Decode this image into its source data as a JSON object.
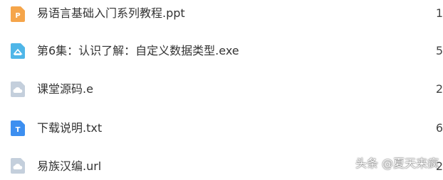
{
  "files": [
    {
      "name": "易语言基础入门系列教程.ppt",
      "count": "1",
      "icon": "ppt-file-icon",
      "color": "#f5a54a"
    },
    {
      "name": "第6集：认识了解：自定义数据类型.exe",
      "count": "5",
      "icon": "exe-file-icon",
      "color": "#4fb6e8"
    },
    {
      "name": "课堂源码.e",
      "count": "2",
      "icon": "generic-file-icon",
      "color": "#c4cfdc"
    },
    {
      "name": "下载说明.txt",
      "count": "6",
      "icon": "txt-file-icon",
      "color": "#3d8ff0"
    },
    {
      "name": "易族汉编.url",
      "count": "2",
      "icon": "generic-file-icon",
      "color": "#c4cfdc"
    }
  ],
  "watermark": "头条 @夏天来疯"
}
